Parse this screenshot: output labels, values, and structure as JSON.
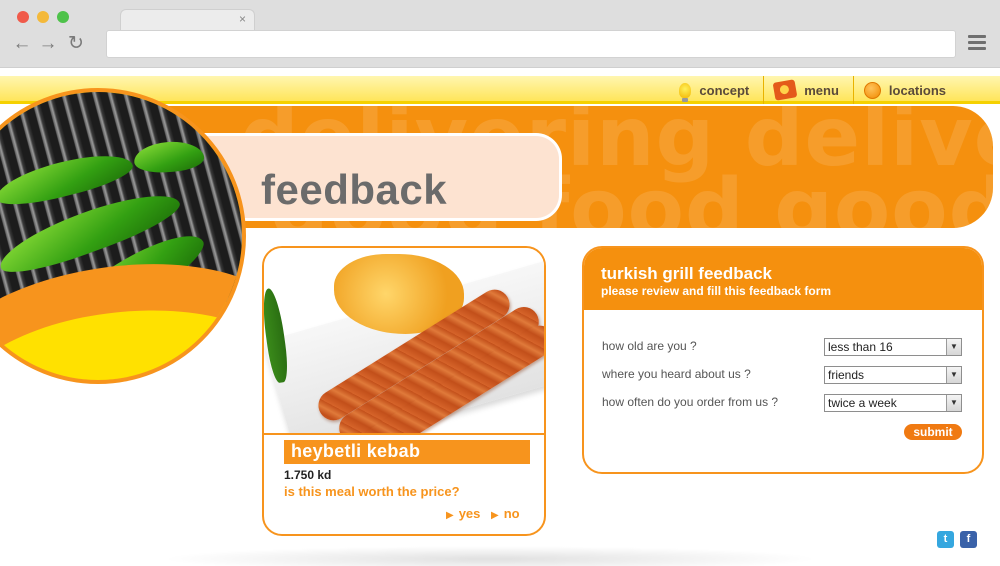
{
  "browser": {
    "tab_close": "×",
    "back_icon": "←",
    "forward_icon": "→",
    "reload_icon": "↻",
    "url": ""
  },
  "topnav": {
    "items": [
      {
        "label": "concept",
        "icon": "lightbulb-icon"
      },
      {
        "label": "menu",
        "icon": "menu-book-icon"
      },
      {
        "label": "locations",
        "icon": "orange-slice-icon"
      }
    ]
  },
  "banner": {
    "watermark_line1": "delivering delivering",
    "watermark_line2": "good food good food"
  },
  "page": {
    "title": "feedback"
  },
  "meal": {
    "name": "heybetli kebab",
    "price": "1.750 kd",
    "question": "is this meal worth the price?",
    "yes_label": "yes",
    "no_label": "no"
  },
  "form": {
    "title": "turkish grill feedback",
    "subtitle": "please review and fill this feedback form",
    "questions": [
      {
        "label": "how old are you ?",
        "value": "less than 16"
      },
      {
        "label": "where you heard about us ?",
        "value": "friends"
      },
      {
        "label": "how often do you order from us ?",
        "value": "twice a week"
      }
    ],
    "submit_label": "submit"
  },
  "social": {
    "twitter": "t",
    "facebook": "f"
  },
  "colors": {
    "accent": "#f7941d",
    "banner": "#f5900e",
    "title_pill": "#fde3d1",
    "topbar": "#ffe55a"
  }
}
